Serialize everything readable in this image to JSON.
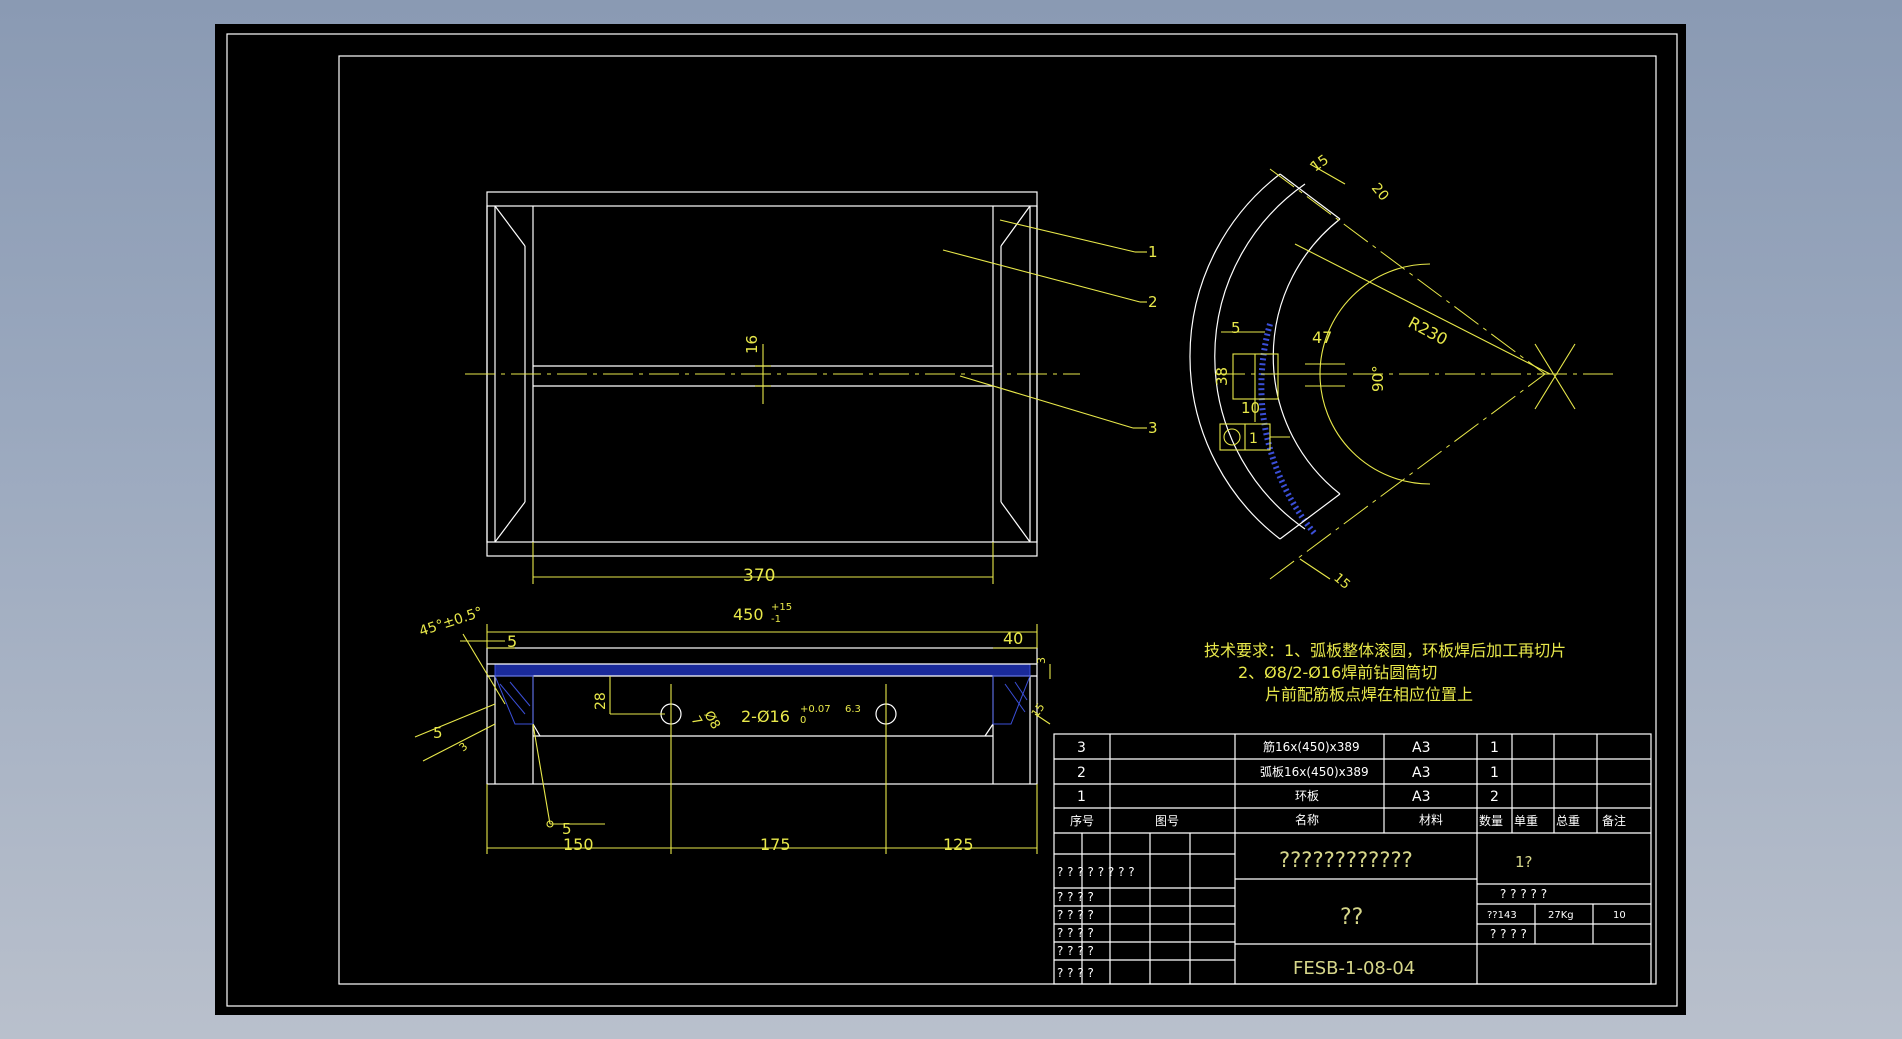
{
  "drawing": {
    "tech_req_1": "技术要求：1、弧板整体滚圆，环板焊后加工再切片",
    "tech_req_2": "2、Ø8/2-Ø16焊前钻圆筒切",
    "tech_req_3": "片前配筋板点焊在相应位置上"
  },
  "dimensions": {
    "d370": "370",
    "d450": "450",
    "d450_tol": "+15",
    "d450_tol2": "-1",
    "d40": "40",
    "d5a": "5",
    "d45": "45°±0.5°",
    "d16": "16",
    "d28": "28",
    "d8": "Ø8",
    "d7": "7",
    "holes": "2-Ø16",
    "holes_tol": "+0.07",
    "holes_tol2": "0",
    "rough": "6.3",
    "d150": "150",
    "d175": "175",
    "d125": "125",
    "weld5a": "5",
    "weld5b": "5",
    "d15a": "15",
    "d20": "20",
    "r230": "R230",
    "d47": "47",
    "d38": "38",
    "d10": "10",
    "a90": "90°",
    "d15b": "15",
    "d15c": "15",
    "weld5c": "5",
    "tol_box": "1",
    "d3a": "3",
    "d3b": "3"
  },
  "balloons": [
    "1",
    "2",
    "3"
  ],
  "parts": [
    {
      "no": "3",
      "code": "",
      "name": "筋16x(450)x389",
      "material": "A3",
      "qty": "1"
    },
    {
      "no": "2",
      "code": "",
      "name": "弧板16x(450)x389",
      "material": "A3",
      "qty": "1"
    },
    {
      "no": "1",
      "code": "",
      "name": "环板",
      "material": "A3",
      "qty": "2"
    }
  ],
  "table_header": {
    "no": "序号",
    "code": "图号",
    "name": "名称",
    "material": "材料",
    "qty": "数量",
    "unit_weight": "单重",
    "total_weight": "总重",
    "remark": "备注"
  },
  "title_block": {
    "title": "????????????",
    "subtitle": "??",
    "scale_label": "1?",
    "q_row": "?  ?      ?  ?     ?",
    "material_code": "??143",
    "weight": "27Kg",
    "sheets": "10",
    "q_row2": "?      ?       ?      ?",
    "drawing_no": "FESB-1-08-04",
    "sig_a": "? ?  ?  ? ? ?   ?   ?",
    "sig_b": "?   ?         ?   ?"
  },
  "colors": {
    "lines": "#ffffff",
    "dims": "#e8e84a",
    "hatch": "#3b4fd8",
    "background": "#000000"
  }
}
